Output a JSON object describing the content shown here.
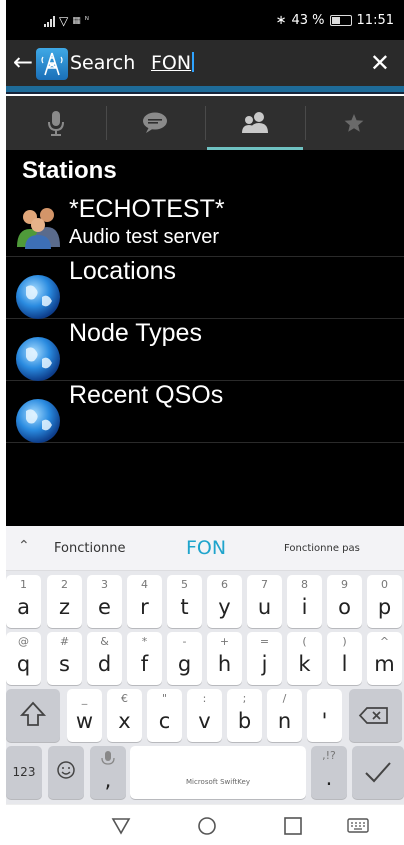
{
  "status_bar": {
    "carrier_icon": "nfc-icon",
    "carrier_text": "ᴺ",
    "battery": "43 %",
    "time": "11:51"
  },
  "toolbar": {
    "back_icon": "back-arrow-icon",
    "logo_icon": "radio-tower-icon",
    "search_label": "Search",
    "query": "FON",
    "close_icon": "close-icon"
  },
  "tabs": [
    {
      "icon": "microphone-icon",
      "active": false
    },
    {
      "icon": "chat-bubble-icon",
      "active": false
    },
    {
      "icon": "people-icon",
      "active": true
    },
    {
      "icon": "star-icon",
      "active": false
    }
  ],
  "stations": {
    "title": "Stations",
    "items": [
      {
        "title": "*ECHOTEST*",
        "subtitle": "Audio test server",
        "icon": "people-group-icon"
      },
      {
        "title": "Locations",
        "subtitle": "",
        "icon": "globe-icon"
      },
      {
        "title": "Node Types",
        "subtitle": "",
        "icon": "globe-icon"
      },
      {
        "title": "Recent QSOs",
        "subtitle": "",
        "icon": "globe-icon"
      }
    ]
  },
  "keyboard": {
    "suggestions": [
      "Fonctionne",
      "FON",
      "Fonctionne pas"
    ],
    "row1": [
      {
        "hint": "1",
        "key": "a"
      },
      {
        "hint": "2",
        "key": "z"
      },
      {
        "hint": "3",
        "key": "e"
      },
      {
        "hint": "4",
        "key": "r"
      },
      {
        "hint": "5",
        "key": "t"
      },
      {
        "hint": "6",
        "key": "y"
      },
      {
        "hint": "7",
        "key": "u"
      },
      {
        "hint": "8",
        "key": "i"
      },
      {
        "hint": "9",
        "key": "o"
      },
      {
        "hint": "0",
        "key": "p"
      }
    ],
    "row2": [
      {
        "hint": "@",
        "key": "q"
      },
      {
        "hint": "#",
        "key": "s"
      },
      {
        "hint": "&",
        "key": "d"
      },
      {
        "hint": "*",
        "key": "f"
      },
      {
        "hint": "-",
        "key": "g"
      },
      {
        "hint": "+",
        "key": "h"
      },
      {
        "hint": "=",
        "key": "j"
      },
      {
        "hint": "(",
        "key": "k"
      },
      {
        "hint": ")",
        "key": "l"
      },
      {
        "hint": "^",
        "key": "m"
      }
    ],
    "row3": [
      {
        "hint": "_",
        "key": "w"
      },
      {
        "hint": "€",
        "key": "x"
      },
      {
        "hint": "\"",
        "key": "c"
      },
      {
        "hint": ":",
        "key": "v"
      },
      {
        "hint": ";",
        "key": "b"
      },
      {
        "hint": "/",
        "key": "n"
      },
      {
        "hint": "",
        "key": "'"
      }
    ],
    "numbers_key": "123",
    "emoji_key_icon": "emoji-icon",
    "comma_key": ",",
    "space_label": "Microsoft SwiftKey",
    "period_key": ".",
    "period_hint": ",!?",
    "shift_icon": "shift-icon",
    "backspace_icon": "backspace-icon",
    "enter_icon": "checkmark-icon",
    "mic_hint_icon": "microphone-icon"
  },
  "nav_bar": {
    "back_icon": "nav-back-triangle-icon",
    "home_icon": "nav-home-circle-icon",
    "recents_icon": "nav-recents-square-icon",
    "keyboard_icon": "keyboard-hide-icon"
  }
}
